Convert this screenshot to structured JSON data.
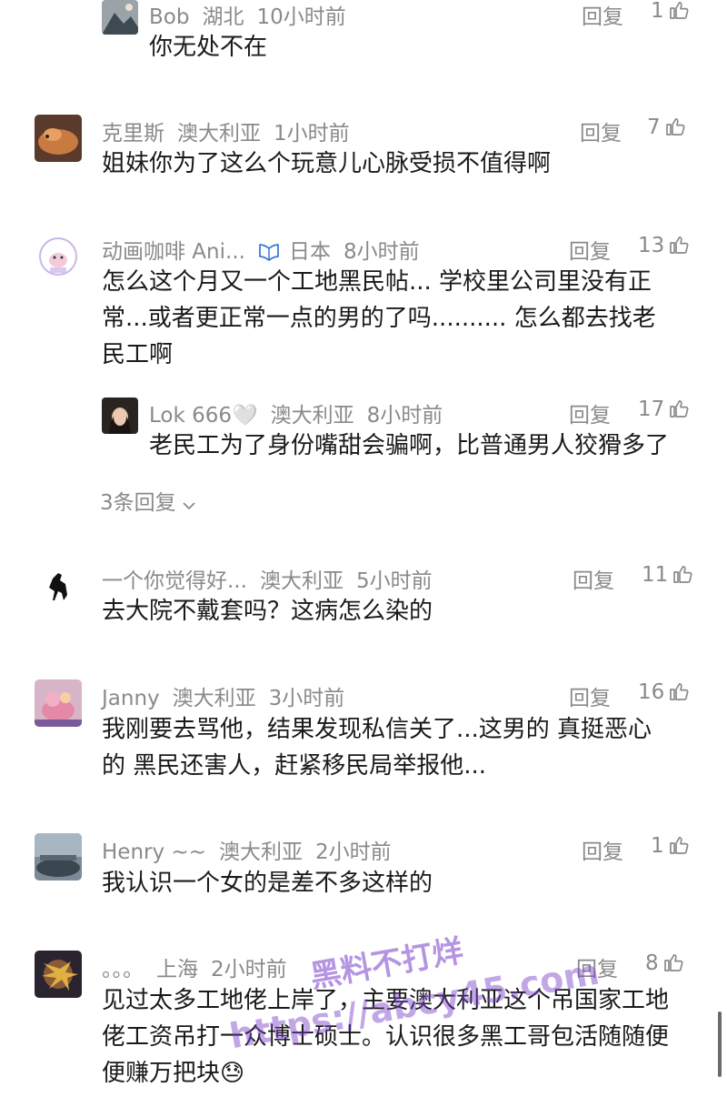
{
  "colors": {
    "text": "#1a1a1a",
    "meta": "#8a8a8a",
    "verified": "#3a7bd5"
  },
  "reply_label": "回复",
  "comments": [
    {
      "user": "Bob",
      "location": "湖北",
      "time": "10小时前",
      "likes": "1",
      "text": [
        "你无处不在"
      ]
    },
    {
      "user": "克里斯",
      "location": "澳大利亚",
      "time": "1小时前",
      "likes": "7",
      "text": [
        "姐妹你为了这么个玩意儿心脉受损不值得啊"
      ]
    },
    {
      "user": "动画咖啡 Ani...",
      "location": "日本",
      "time": "8小时前",
      "likes": "13",
      "text": [
        "怎么这个月又一个工地黑民帖... 学校里公司里没有正",
        "常...或者更正常一点的男的了吗..........  怎么都去找老",
        "民工啊"
      ]
    },
    {
      "user": "Lok 666🤍",
      "location": "澳大利亚",
      "time": "8小时前",
      "likes": "17",
      "text": [
        "老民工为了身份嘴甜会骗啊，比普通男人狡猾多了"
      ]
    },
    {
      "user": "一个你觉得好...",
      "location": "澳大利亚",
      "time": "5小时前",
      "likes": "11",
      "text": [
        "去大院不戴套吗？这病怎么染的"
      ]
    },
    {
      "user": "Janny",
      "location": "澳大利亚",
      "time": "3小时前",
      "likes": "16",
      "text": [
        "我刚要去骂他，结果发现私信关了...这男的 真挺恶心",
        "的  黑民还害人，赶紧移民局举报他..."
      ]
    },
    {
      "user": "Henry ~~",
      "location": "澳大利亚",
      "time": "2小时前",
      "likes": "1",
      "text": [
        "我认识一个女的是差不多这样的"
      ]
    },
    {
      "user": "。。。",
      "location": "上海",
      "time": "2小时前",
      "likes": "8",
      "text": [
        "见过太多工地佬上岸了，主要澳大利亚这个吊国家工地",
        "佬工资吊打一众博士硕士。认识很多黑工哥包活随随便",
        "便赚万把块😓"
      ]
    }
  ],
  "more_replies": "3条回复",
  "watermark": {
    "line1": "黑料不打烊",
    "line2": "https://abcy45.com"
  }
}
